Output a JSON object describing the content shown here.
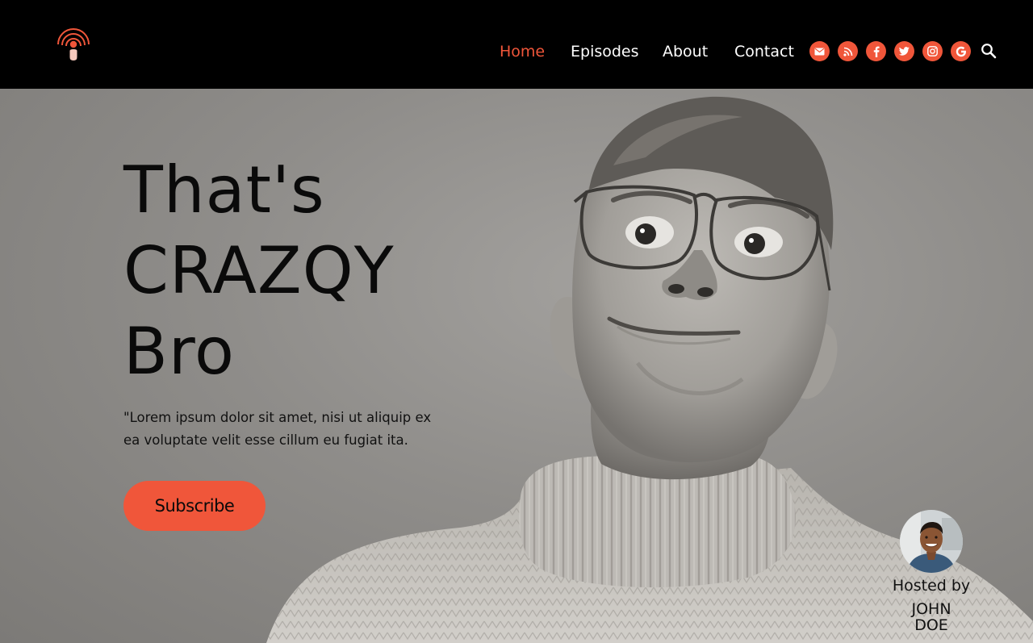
{
  "brand": {
    "accent_color": "#f0563a",
    "logo_icon": "podcast-mic-icon"
  },
  "nav": {
    "items": [
      {
        "label": "Home",
        "active": true
      },
      {
        "label": "Episodes",
        "active": false
      },
      {
        "label": "About",
        "active": false
      },
      {
        "label": "Contact",
        "active": false
      }
    ]
  },
  "social": {
    "icons": [
      "mail-icon",
      "rss-icon",
      "facebook-icon",
      "twitter-icon",
      "instagram-icon",
      "google-icon"
    ],
    "search_icon": "search-icon"
  },
  "hero": {
    "title_lines": [
      "That's",
      "CRAZQY",
      "Bro"
    ],
    "text": "\"Lorem ipsum dolor sit amet,  nisi ut aliquip ex ea voluptate velit esse cillum eu fugiat ita.",
    "subscribe_label": "Subscribe"
  },
  "host": {
    "label": "Hosted by",
    "name": "JOHN DOE"
  }
}
